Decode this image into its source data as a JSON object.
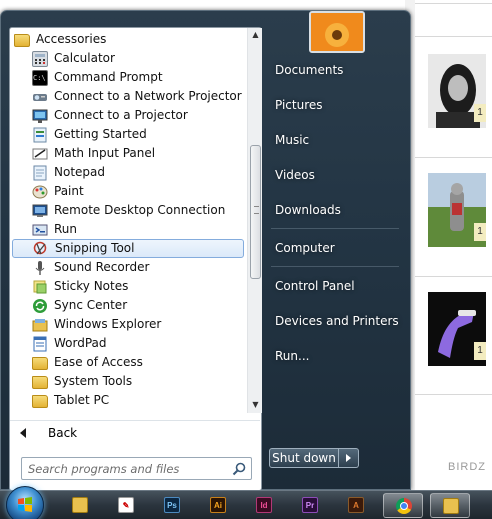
{
  "programs": {
    "folder_title": "Accessories",
    "items": [
      {
        "label": "Calculator",
        "icon": "calculator-icon"
      },
      {
        "label": "Command Prompt",
        "icon": "command-prompt-icon"
      },
      {
        "label": "Connect to a Network Projector",
        "icon": "network-projector-icon"
      },
      {
        "label": "Connect to a Projector",
        "icon": "projector-icon"
      },
      {
        "label": "Getting Started",
        "icon": "getting-started-icon"
      },
      {
        "label": "Math Input Panel",
        "icon": "math-input-icon"
      },
      {
        "label": "Notepad",
        "icon": "notepad-icon"
      },
      {
        "label": "Paint",
        "icon": "paint-icon"
      },
      {
        "label": "Remote Desktop Connection",
        "icon": "remote-desktop-icon"
      },
      {
        "label": "Run",
        "icon": "run-icon"
      },
      {
        "label": "Snipping Tool",
        "icon": "snipping-tool-icon",
        "selected": true
      },
      {
        "label": "Sound Recorder",
        "icon": "microphone-icon"
      },
      {
        "label": "Sticky Notes",
        "icon": "sticky-notes-icon"
      },
      {
        "label": "Sync Center",
        "icon": "sync-center-icon"
      },
      {
        "label": "Windows Explorer",
        "icon": "windows-explorer-icon"
      },
      {
        "label": "WordPad",
        "icon": "wordpad-icon"
      },
      {
        "label": "Ease of Access",
        "icon": "folder-icon"
      },
      {
        "label": "System Tools",
        "icon": "folder-icon"
      },
      {
        "label": "Tablet PC",
        "icon": "folder-icon"
      }
    ],
    "back_label": "Back"
  },
  "search": {
    "placeholder": "Search programs and files"
  },
  "places": {
    "items": [
      "Documents",
      "Pictures",
      "Music",
      "Videos",
      "Downloads",
      "Computer",
      "Control Panel",
      "Devices and Printers",
      "Run..."
    ]
  },
  "shutdown": {
    "label": "Shut down"
  },
  "taskbar": {
    "buttons": [
      "windows-explorer-icon",
      "adobe-acrobat-icon",
      "photoshop-icon",
      "illustrator-icon",
      "indesign-icon",
      "premiere-icon",
      "autodesk-icon",
      "chrome-icon"
    ]
  },
  "background_page": {
    "badges": [
      "1",
      "1",
      "1"
    ],
    "watermark": "BIRDZ"
  },
  "colors": {
    "menu_dark": "#233544",
    "selection_border": "#84acdd",
    "taskbar": "#2b353e"
  }
}
